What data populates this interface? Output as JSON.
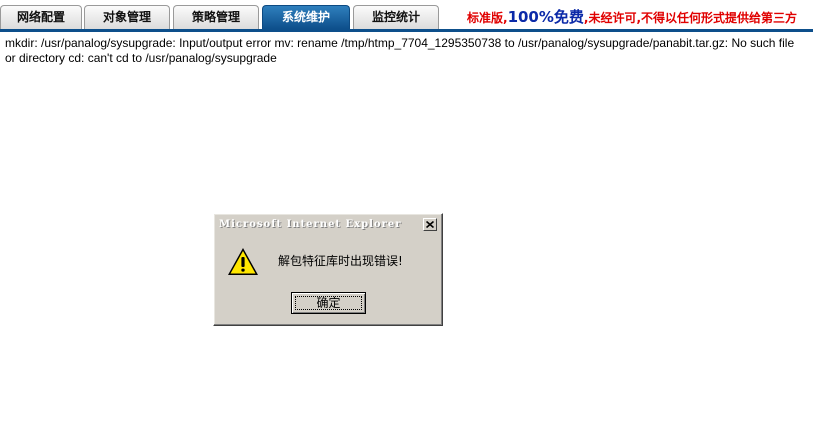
{
  "tabs": [
    {
      "label": "网络配置",
      "active": false
    },
    {
      "label": "对象管理",
      "active": false
    },
    {
      "label": "策略管理",
      "active": false
    },
    {
      "label": "系统维护",
      "active": true
    },
    {
      "label": "监控统计",
      "active": false
    }
  ],
  "notice": {
    "part1": "标准版,",
    "highlight": "100%免费",
    "part2": ",未经许可,不得以任何形式提供给第三方"
  },
  "error_message": "mkdir: /usr/panalog/sysupgrade: Input/output error mv: rename /tmp/htmp_7704_1295350738 to /usr/panalog/sysupgrade/panabit.tar.gz: No such file or directory cd: can't cd to /usr/panalog/sysupgrade",
  "dialog": {
    "title": "Microsoft Internet Explorer",
    "message": "解包特征库时出现错误!",
    "ok_label": "确定",
    "icon": "warning-icon"
  },
  "colors": {
    "active_tab": "#0d4f8b",
    "notice_red": "#e00000",
    "notice_blue": "#0b2aa8",
    "dialog_face": "#d4d0c8"
  }
}
